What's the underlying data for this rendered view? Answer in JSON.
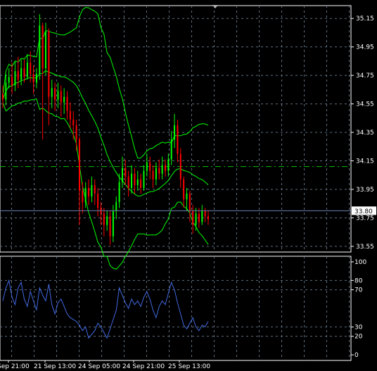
{
  "chart_data": [
    {
      "type": "candlestick",
      "panel": "price",
      "yticks": [
        "35.15",
        "34.95",
        "34.75",
        "34.55",
        "34.35",
        "34.15",
        "33.95",
        "33.75",
        "33.55"
      ],
      "ylim": [
        33.51,
        35.24
      ],
      "grid": true,
      "current_price": "33.80",
      "level_line": 34.11,
      "colors": {
        "up": "#00ff00",
        "down": "#ff0000",
        "bands": "#00ff00",
        "level": "#00c000",
        "grid": "#607080",
        "current_line": "#6e7fb0",
        "background": "#000000"
      },
      "candles": [
        [
          34.62,
          34.58,
          34.68,
          34.52
        ],
        [
          34.58,
          34.7,
          34.76,
          34.54
        ],
        [
          34.7,
          34.74,
          34.8,
          34.66
        ],
        [
          34.74,
          34.68,
          34.84,
          34.62
        ],
        [
          34.68,
          34.78,
          34.85,
          34.64
        ],
        [
          34.78,
          34.72,
          34.88,
          34.66
        ],
        [
          34.72,
          34.8,
          34.86,
          34.68
        ],
        [
          34.8,
          34.74,
          34.86,
          34.7
        ],
        [
          34.74,
          34.84,
          34.9,
          34.72
        ],
        [
          34.84,
          34.76,
          34.92,
          34.7
        ],
        [
          34.76,
          34.7,
          34.82,
          34.62
        ],
        [
          34.7,
          34.76,
          34.8,
          34.66
        ],
        [
          34.76,
          35.1,
          35.18,
          34.72
        ],
        [
          35.1,
          34.8,
          35.12,
          34.3
        ],
        [
          34.8,
          35.06,
          35.12,
          34.75
        ],
        [
          35.06,
          34.6,
          35.08,
          34.4
        ],
        [
          34.6,
          34.66,
          34.72,
          34.52
        ],
        [
          34.66,
          34.58,
          34.7,
          34.5
        ],
        [
          34.58,
          34.64,
          34.7,
          34.52
        ],
        [
          34.64,
          34.56,
          34.68,
          34.46
        ],
        [
          34.56,
          34.6,
          34.66,
          34.48
        ],
        [
          34.6,
          34.5,
          34.64,
          34.44
        ],
        [
          34.5,
          34.44,
          34.56,
          34.38
        ],
        [
          34.44,
          34.4,
          34.5,
          34.3
        ],
        [
          34.4,
          34.3,
          34.44,
          34.22
        ],
        [
          34.3,
          33.94,
          34.32,
          33.7
        ],
        [
          33.94,
          33.86,
          34.0,
          33.78
        ],
        [
          33.86,
          33.96,
          34.0,
          33.82
        ],
        [
          33.96,
          33.9,
          34.02,
          33.84
        ],
        [
          33.9,
          33.98,
          34.04,
          33.86
        ],
        [
          33.98,
          33.92,
          34.02,
          33.84
        ],
        [
          33.92,
          33.82,
          33.96,
          33.76
        ],
        [
          33.82,
          33.78,
          33.86,
          33.7
        ],
        [
          33.78,
          33.7,
          33.82,
          33.62
        ],
        [
          33.7,
          33.76,
          33.8,
          33.66
        ],
        [
          33.76,
          33.62,
          33.8,
          33.56
        ],
        [
          33.62,
          33.8,
          33.84,
          33.58
        ],
        [
          33.8,
          33.86,
          33.9,
          33.74
        ],
        [
          33.86,
          34.0,
          34.06,
          33.82
        ],
        [
          34.0,
          34.1,
          34.18,
          33.96
        ],
        [
          34.1,
          34.04,
          34.16,
          33.98
        ],
        [
          34.04,
          33.96,
          34.08,
          33.9
        ],
        [
          33.96,
          34.06,
          34.12,
          33.92
        ],
        [
          34.06,
          33.98,
          34.1,
          33.92
        ],
        [
          33.98,
          34.02,
          34.08,
          33.94
        ],
        [
          34.02,
          33.96,
          34.06,
          33.92
        ],
        [
          33.96,
          34.08,
          34.12,
          33.94
        ],
        [
          34.08,
          34.14,
          34.2,
          34.04
        ],
        [
          34.14,
          34.08,
          34.18,
          34.02
        ],
        [
          34.08,
          34.02,
          34.12,
          33.96
        ],
        [
          34.02,
          34.1,
          34.14,
          33.98
        ],
        [
          34.1,
          34.06,
          34.16,
          34.02
        ],
        [
          34.06,
          34.12,
          34.18,
          34.02
        ],
        [
          34.12,
          34.08,
          34.16,
          34.04
        ],
        [
          34.08,
          34.16,
          34.2,
          34.04
        ],
        [
          34.16,
          34.3,
          34.36,
          34.12
        ],
        [
          34.3,
          34.4,
          34.48,
          34.24
        ],
        [
          34.4,
          34.2,
          34.44,
          34.14
        ],
        [
          34.2,
          34.02,
          34.24,
          33.96
        ],
        [
          34.02,
          33.88,
          34.04,
          33.82
        ],
        [
          33.88,
          33.92,
          33.96,
          33.8
        ],
        [
          33.92,
          33.8,
          33.94,
          33.72
        ],
        [
          33.8,
          33.7,
          33.84,
          33.64
        ],
        [
          33.7,
          33.78,
          33.82,
          33.66
        ],
        [
          33.78,
          33.72,
          33.82,
          33.68
        ],
        [
          33.72,
          33.8,
          33.84,
          33.7
        ],
        [
          33.8,
          33.76,
          33.82,
          33.72
        ],
        [
          33.76,
          33.74,
          33.8,
          33.7
        ]
      ]
    },
    {
      "type": "line",
      "panel": "oscillator",
      "yticks": [
        "100",
        "80",
        "70",
        "30",
        "20",
        "0"
      ],
      "ylim": [
        -6,
        106
      ],
      "levels": [
        80,
        70,
        30,
        20
      ],
      "colors": {
        "line": "#4169e1",
        "grid": "#607080"
      },
      "values": [
        58,
        72,
        80,
        62,
        54,
        72,
        78,
        60,
        52,
        68,
        58,
        48,
        72,
        64,
        58,
        76,
        54,
        44,
        56,
        60,
        52,
        44,
        40,
        38,
        36,
        32,
        26,
        30,
        18,
        22,
        26,
        34,
        30,
        24,
        18,
        28,
        38,
        48,
        72,
        64,
        56,
        50,
        60,
        54,
        58,
        52,
        62,
        68,
        60,
        48,
        40,
        52,
        58,
        54,
        66,
        78,
        70,
        56,
        44,
        32,
        28,
        34,
        40,
        30,
        26,
        32,
        30,
        36
      ]
    }
  ],
  "time_axis": {
    "labels": [
      "Sep 21:00",
      "21 Sep 13:00",
      "24 Sep 05:00",
      "24 Sep 21:00",
      "25 Sep 13:00"
    ]
  }
}
